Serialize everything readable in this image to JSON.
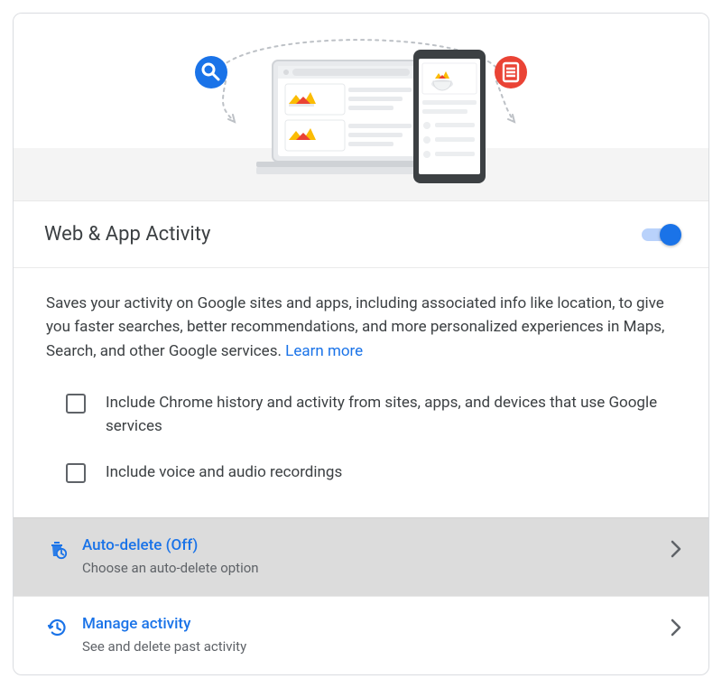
{
  "title": "Web & App Activity",
  "toggle_on": true,
  "description": "Saves your activity on Google sites and apps, including associated info like location, to give you faster searches, better recommendations, and more personalized experiences in Maps, Search, and other Google services. ",
  "learn_more": "Learn more",
  "checkboxes": [
    {
      "label": "Include Chrome history and activity from sites, apps, and devices that use Google services",
      "checked": false
    },
    {
      "label": "Include voice and audio recordings",
      "checked": false
    }
  ],
  "rows": {
    "auto_delete": {
      "title": "Auto-delete (Off)",
      "subtitle": "Choose an auto-delete option"
    },
    "manage": {
      "title": "Manage activity",
      "subtitle": "See and delete past activity"
    }
  },
  "colors": {
    "primary": "#1a73e8",
    "red": "#ea4335"
  }
}
